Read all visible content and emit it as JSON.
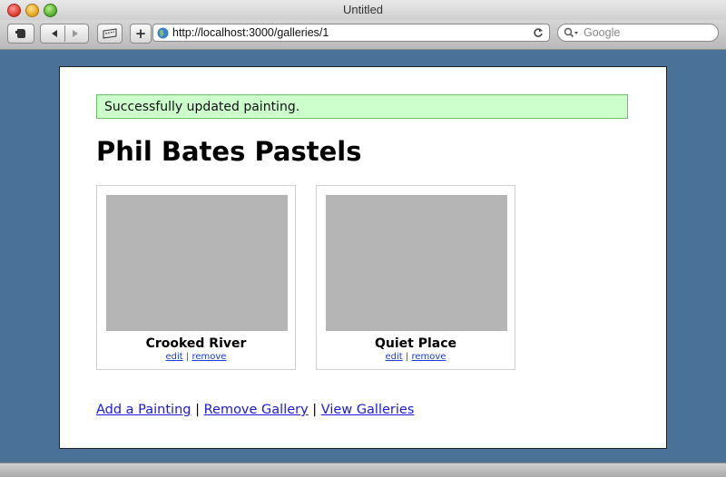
{
  "window": {
    "title": "Untitled"
  },
  "toolbar": {
    "url": "http://localhost:3000/galleries/1",
    "search_placeholder": "Google",
    "add_tab_label": "+"
  },
  "page": {
    "flash": "Successfully updated painting.",
    "heading": "Phil Bates Pastels",
    "paintings": [
      {
        "name": "Crooked River",
        "edit": "edit",
        "remove": "remove"
      },
      {
        "name": "Quiet Place",
        "edit": "edit",
        "remove": "remove"
      }
    ],
    "links": {
      "add": "Add a Painting",
      "remove": "Remove Gallery",
      "view": "View Galleries",
      "separator": "|"
    }
  }
}
